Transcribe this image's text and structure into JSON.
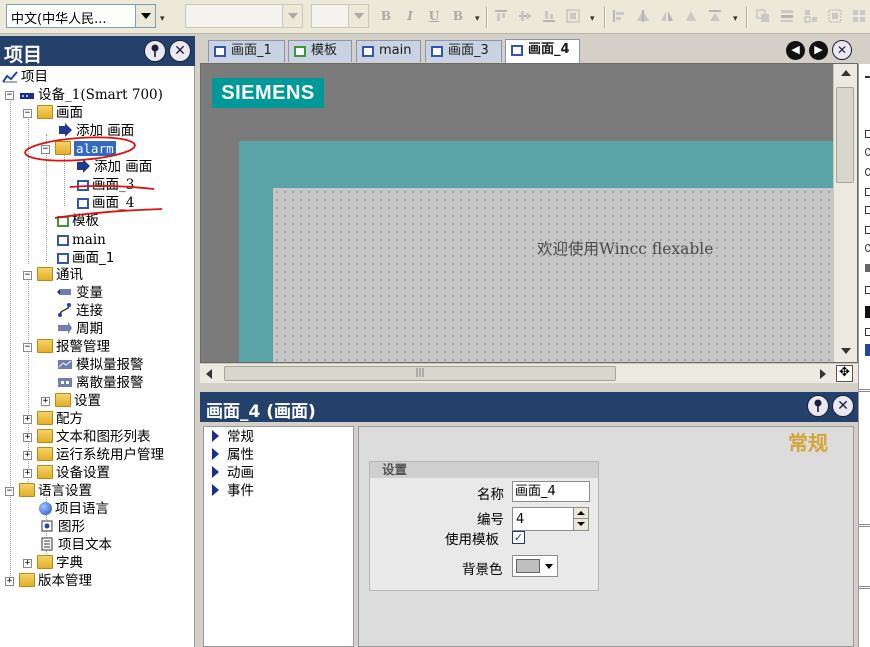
{
  "toolbar": {
    "language_combo": "中文(中华人民...",
    "font_combo": "",
    "size_combo": "",
    "bold_label": "B",
    "italic_label": "I",
    "underline_label": "U",
    "strike_label": "B"
  },
  "project_panel": {
    "title": "项目"
  },
  "tree": {
    "root": "项目",
    "device": "设备_1(Smart 700)",
    "screens_folder": "画面",
    "add_screen": "添加 画面",
    "alarm_folder": "alarm",
    "alarm_add_screen": "添加 画面",
    "screen_3": "画面_3",
    "screen_4": "画面_4",
    "template": "模板",
    "main": "main",
    "screen_1": "画面_1",
    "comm": "通讯",
    "tags": "变量",
    "connections": "连接",
    "cycles": "周期",
    "alarm_mgmt": "报警管理",
    "analog_alarms": "模拟量报警",
    "discrete_alarms": "离散量报警",
    "settings": "设置",
    "recipes": "配方",
    "text_graphic_lists": "文本和图形列表",
    "runtime_users": "运行系统用户管理",
    "device_settings": "设备设置",
    "lang_settings": "语言设置",
    "project_languages": "项目语言",
    "graphics": "图形",
    "project_texts": "项目文本",
    "dictionary": "字典",
    "version_mgmt": "版本管理"
  },
  "tabs": [
    {
      "label": "画面_1"
    },
    {
      "label": "模板"
    },
    {
      "label": "main"
    },
    {
      "label": "画面_3"
    },
    {
      "label": "画面_4"
    }
  ],
  "editor": {
    "logo": "SIEMENS",
    "welcome_text": "欢迎使用Wincc flexable"
  },
  "properties": {
    "title": "画面_4 (画面)",
    "nav": [
      "常规",
      "属性",
      "动画",
      "事件"
    ],
    "section_heading": "常规",
    "group_title": "设置",
    "name_label": "名称",
    "name_value": "画面_4",
    "number_label": "编号",
    "number_value": "4",
    "use_template_label": "使用模板",
    "background_label": "背景色"
  },
  "colors": {
    "panel_header": "#23416b",
    "siemens_teal": "#009999",
    "screen_frame": "#5aa3a6",
    "heading_gold": "#d3a437",
    "selection": "#316ac5",
    "annotation_red": "#e01010"
  }
}
